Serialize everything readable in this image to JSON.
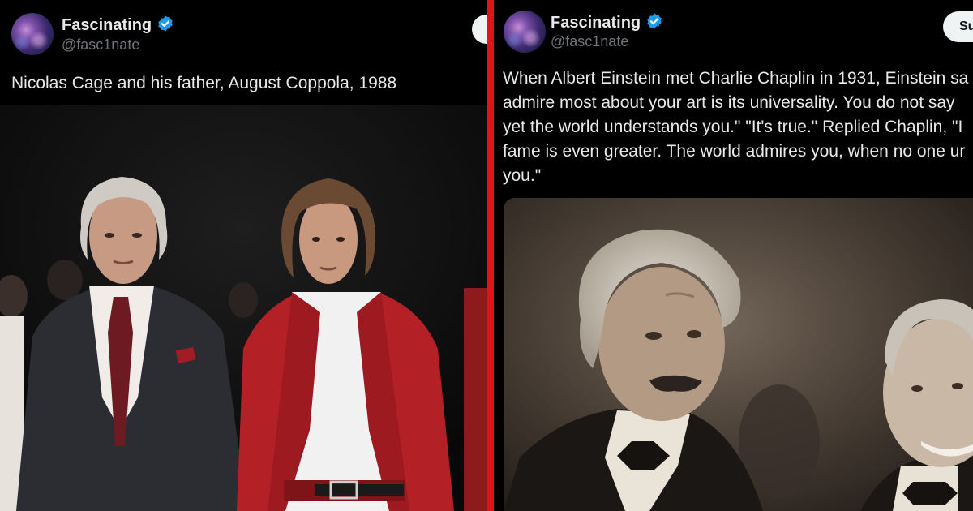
{
  "left_post": {
    "display_name": "Fascinating",
    "handle": "@fasc1nate",
    "text": "Nicolas Cage and his father, August Coppola, 1988",
    "verified": true
  },
  "right_post": {
    "display_name": "Fascinating",
    "handle": "@fasc1nate",
    "subscribe_label": "Su",
    "text_lines": [
      "When Albert Einstein met Charlie Chaplin in 1931, Einstein sa",
      "admire most about your art is its universality. You do not say",
      "yet the world understands you.\" \"It's true.\" Replied Chaplin, \"I",
      "fame is even greater. The world admires you, when no one ur",
      "you.\""
    ],
    "verified": true
  },
  "colors": {
    "background": "#000000",
    "divider": "#e0121b",
    "verified_badge": "#1d9bf0",
    "text_primary": "#e7e9ea",
    "text_secondary": "#71767b"
  },
  "icons": {
    "verified": "verified-badge-icon"
  }
}
